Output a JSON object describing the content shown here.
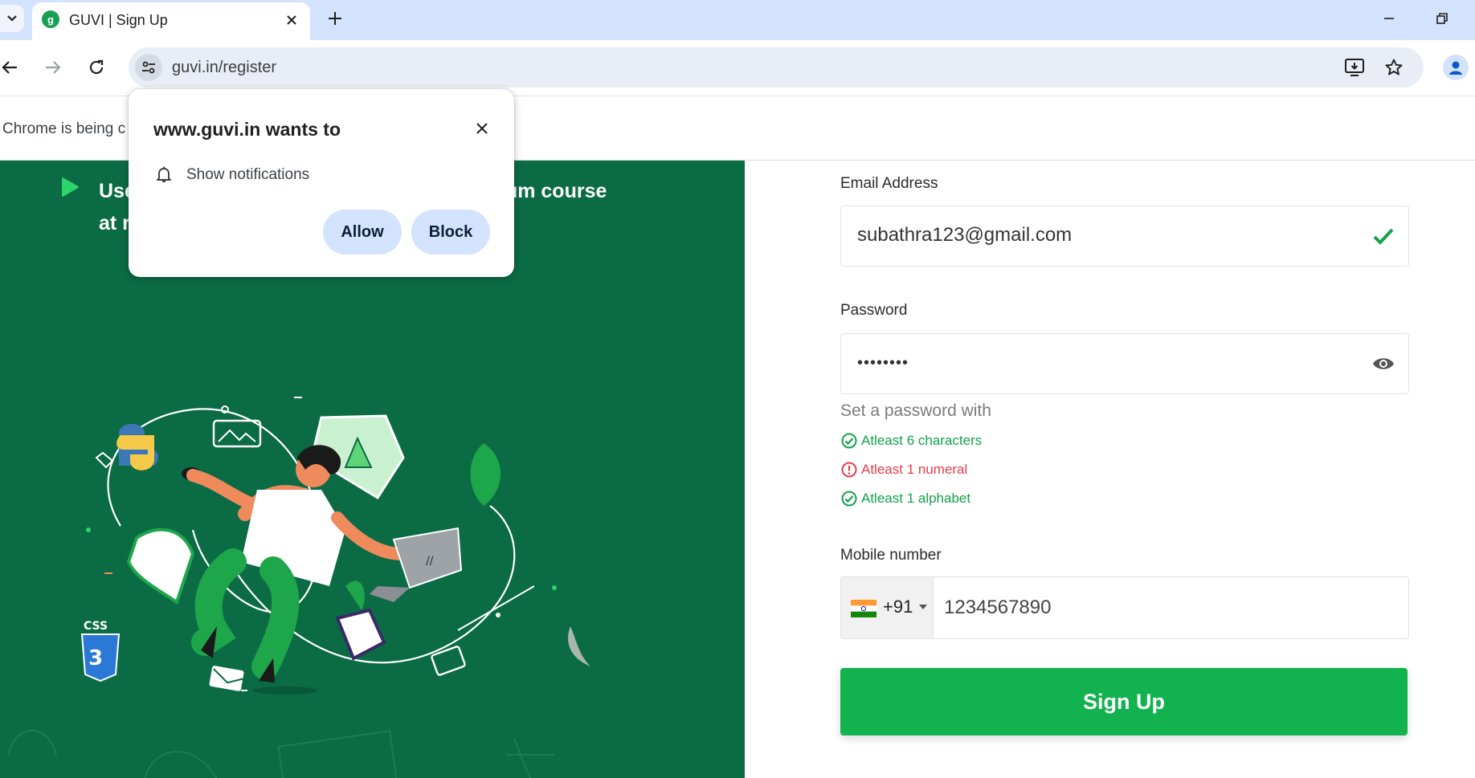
{
  "browser": {
    "tab": {
      "title": "GUVI | Sign Up",
      "favicon_letter": "g"
    },
    "url": "guvi.in/register",
    "infobar": {
      "text": "Chrome is being c"
    }
  },
  "permission_popup": {
    "title": "www.guvi.in wants to",
    "item": "Show notifications",
    "allow_label": "Allow",
    "block_label": "Block"
  },
  "promo": {
    "line1_left": "Use",
    "line1_right": "emium course",
    "line2_left": "at r"
  },
  "form": {
    "email": {
      "label": "Email Address",
      "value": "subathra123@gmail.com"
    },
    "password": {
      "label": "Password",
      "value": "••••••••"
    },
    "password_hint": {
      "title": "Set a password with",
      "rules": [
        {
          "text": "Atleast 6 characters",
          "status": "ok"
        },
        {
          "text": "Atleast 1 numeral",
          "status": "error"
        },
        {
          "text": "Atleast 1 alphabet",
          "status": "ok"
        }
      ]
    },
    "mobile": {
      "label": "Mobile number",
      "dial_code": "+91",
      "value": "1234567890"
    },
    "submit_label": "Sign Up"
  },
  "colors": {
    "panel_green": "#0b6b45",
    "button_green": "#12b24f",
    "ok_green": "#13a24a",
    "error_red": "#e53e4c",
    "chrome_blue": "#d3e3fd"
  }
}
